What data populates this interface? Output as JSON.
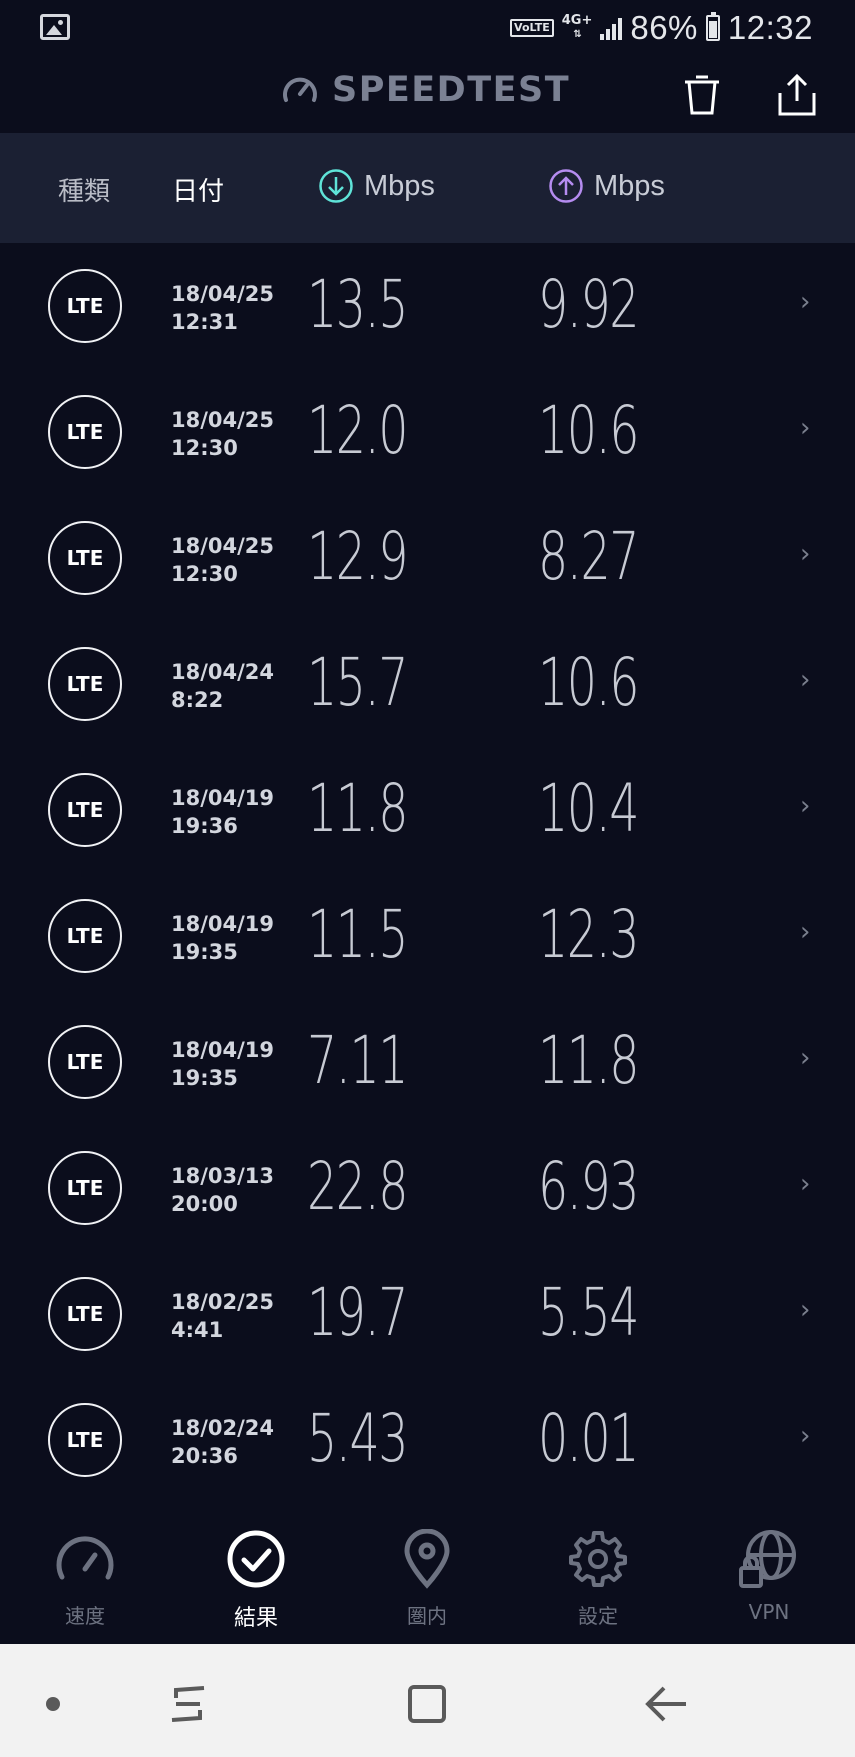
{
  "status_bar": {
    "volte": "VoLTE",
    "network": "4G+",
    "network_arrows": "⇅",
    "battery": "86%",
    "time": "12:32"
  },
  "header": {
    "title": "SPEEDTEST",
    "icons": [
      "speedometer-logo-icon",
      "trash-icon",
      "share-icon"
    ]
  },
  "columns": {
    "type": "種類",
    "date": "日付",
    "download_unit": "Mbps",
    "upload_unit": "Mbps",
    "download_color": "#5fe3d8",
    "upload_color": "#b58cf0"
  },
  "results": [
    {
      "type": "LTE",
      "date": "18/04/25",
      "time": "12:31",
      "download": "13.5",
      "upload": "9.92"
    },
    {
      "type": "LTE",
      "date": "18/04/25",
      "time": "12:30",
      "download": "12.0",
      "upload": "10.6"
    },
    {
      "type": "LTE",
      "date": "18/04/25",
      "time": "12:30",
      "download": "12.9",
      "upload": "8.27"
    },
    {
      "type": "LTE",
      "date": "18/04/24",
      "time": "8:22",
      "download": "15.7",
      "upload": "10.6"
    },
    {
      "type": "LTE",
      "date": "18/04/19",
      "time": "19:36",
      "download": "11.8",
      "upload": "10.4"
    },
    {
      "type": "LTE",
      "date": "18/04/19",
      "time": "19:35",
      "download": "11.5",
      "upload": "12.3"
    },
    {
      "type": "LTE",
      "date": "18/04/19",
      "time": "19:35",
      "download": "7.11",
      "upload": "11.8"
    },
    {
      "type": "LTE",
      "date": "18/03/13",
      "time": "20:00",
      "download": "22.8",
      "upload": "6.93"
    },
    {
      "type": "LTE",
      "date": "18/02/25",
      "time": "4:41",
      "download": "19.7",
      "upload": "5.54"
    },
    {
      "type": "LTE",
      "date": "18/02/24",
      "time": "20:36",
      "download": "5.43",
      "upload": "0.01"
    }
  ],
  "nav": {
    "items": [
      {
        "label": "速度",
        "icon": "speedometer-icon"
      },
      {
        "label": "結果",
        "icon": "check-circle-icon",
        "active": true
      },
      {
        "label": "圏内",
        "icon": "map-pin-icon"
      },
      {
        "label": "設定",
        "icon": "gear-icon"
      },
      {
        "label": "VPN",
        "icon": "globe-lock-icon"
      }
    ]
  },
  "system_nav": [
    "dot-icon",
    "recent-apps-icon",
    "home-icon",
    "back-icon"
  ]
}
